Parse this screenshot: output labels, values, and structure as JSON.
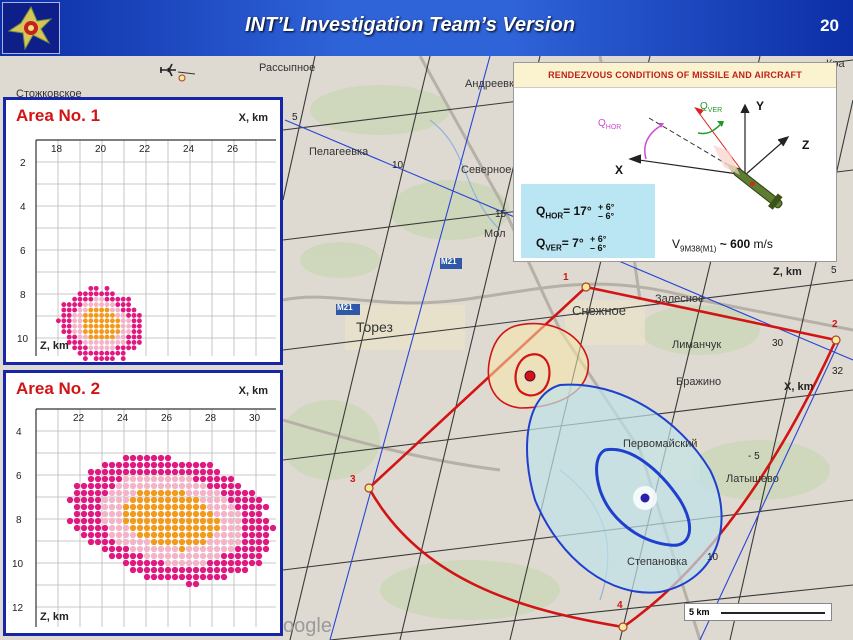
{
  "header": {
    "title": "INT’L Investigation Team’s Version",
    "slide_number": "20",
    "logo_icon": "investigation-team-emblem-icon"
  },
  "rendezvous": {
    "title": "RENDEZVOUS  CONDITIONS  OF  MISSILE  AND  AIRCRAFT",
    "q_hor_label": "Q",
    "q_hor_sub": "HOR",
    "q_ver_label": "Q",
    "q_ver_sub": "VER",
    "axis_x": "X",
    "axis_y": "Y",
    "axis_z": "Z",
    "eq_hor_prefix": "Q",
    "eq_hor_sub": "HOR",
    "eq_hor_value": "= 17°",
    "eq_hor_tol_plus": "+ 6°",
    "eq_hor_tol_minus": "– 6°",
    "eq_ver_prefix": "Q",
    "eq_ver_sub": "VER",
    "eq_ver_value": "= 7°",
    "eq_ver_tol_plus": "+ 6°",
    "eq_ver_tol_minus": "– 6°",
    "speed_prefix": "V",
    "speed_sub": "9M38(M1)",
    "speed_value": " ~ 600",
    "speed_unit": " m/s",
    "missile_icon": "missile-icon"
  },
  "area1": {
    "title": "Area No. 1",
    "x_axis_label": "X, km",
    "z_axis_label": "Z, km",
    "x_ticks": [
      "18",
      "20",
      "22",
      "24",
      "26"
    ],
    "z_ticks": [
      "2",
      "4",
      "6",
      "8",
      "10"
    ]
  },
  "area2": {
    "title": "Area No. 2",
    "x_axis_label": "X, km",
    "z_axis_label": "Z, km",
    "x_ticks": [
      "22",
      "24",
      "26",
      "28",
      "30"
    ],
    "z_ticks": [
      "4",
      "6",
      "8",
      "10",
      "12"
    ]
  },
  "map": {
    "labels": {
      "rassypnoe": "Рассыпное",
      "stozhkovskoe": "Стожковское",
      "andreevka": "Андреевка",
      "pelageevka": "Пелагеевка",
      "severnoe": "Северное",
      "molo": "Мол",
      "torez": "Торез",
      "snezhnoe": "Снежное",
      "zalesnoe": "Залесное",
      "limanchuk": "Лиманчук",
      "brazhino": "Бражино",
      "pervomaisky": "Первомайский",
      "latyshevo": "Латышево",
      "stepanovka": "Степановка",
      "kra": "Кра",
      "road_m21_a": "M21",
      "road_m21_b": "M21"
    },
    "grid_labels": {
      "z_km": "Z, km",
      "x_km": "X, km",
      "g5_top": "5",
      "g10": "10",
      "g15": "15",
      "g30": "30",
      "g32": "32",
      "g5_right": "5",
      "gm5": "- 5",
      "g10_bottom": "10"
    },
    "points": [
      "1",
      "2",
      "3",
      "4"
    ],
    "scale_label": "5 km",
    "watermark": "oogle",
    "aircraft_icon": "aircraft-icon"
  },
  "colors": {
    "header_blue": "#1f48c4",
    "panel_border": "#1626a8",
    "boundary_red": "#d21414",
    "area1_zone": "#f7e7a8",
    "area2_zone": "#bfe3ea",
    "area2_border": "#1f3fcf",
    "dot_magenta": "#e0187f",
    "dot_pink": "#f4b4c7",
    "dot_orange": "#f39a1c"
  }
}
